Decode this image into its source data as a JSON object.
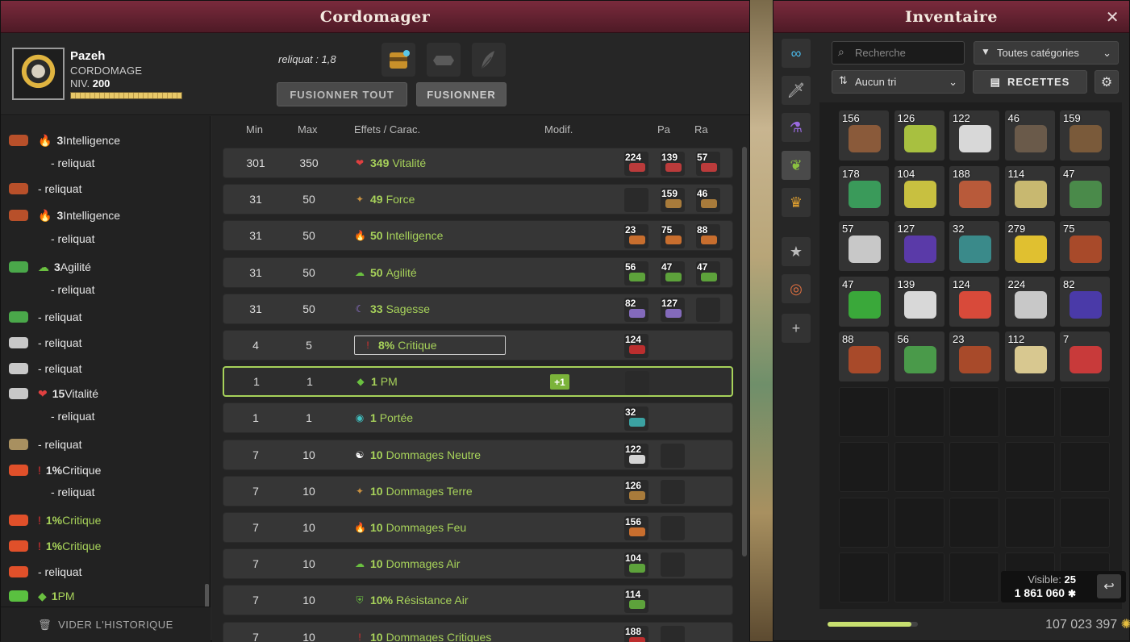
{
  "craft": {
    "title": "Cordomager",
    "player": {
      "name": "Pazeh",
      "job": "CORDOMAGE",
      "level_label": "NIV.",
      "level": "200"
    },
    "reliquat": "reliquat : 1,8",
    "buttons": {
      "fuse_all": "FUSIONNER TOUT",
      "fuse": "FUSIONNER"
    },
    "history_clear": "VIDER L'HISTORIQUE",
    "history": [
      {
        "icon": "rune-red",
        "bold": "3",
        "text": "Intelligence",
        "green": false,
        "stat": "fire"
      },
      {
        "icon": "",
        "bold": "",
        "text": "- reliquat",
        "green": false,
        "sub": true
      },
      {
        "icon": "rune-red",
        "bold": "",
        "text": "- reliquat",
        "green": false
      },
      {
        "icon": "rune-red",
        "bold": "3",
        "text": "Intelligence",
        "green": false,
        "stat": "fire"
      },
      {
        "icon": "",
        "bold": "",
        "text": "- reliquat",
        "green": false,
        "sub": true
      },
      {
        "icon": "rune-green",
        "bold": "3",
        "text": "Agilité",
        "green": false,
        "stat": "air"
      },
      {
        "icon": "",
        "bold": "",
        "text": "- reliquat",
        "green": false,
        "sub": true
      },
      {
        "icon": "rune-green",
        "bold": "",
        "text": "- reliquat",
        "green": false
      },
      {
        "icon": "rune-white",
        "bold": "",
        "text": "- reliquat",
        "green": false
      },
      {
        "icon": "rune-white",
        "bold": "",
        "text": "- reliquat",
        "green": false
      },
      {
        "icon": "rune-white",
        "bold": "15",
        "text": "Vitalité",
        "green": false,
        "stat": "heart"
      },
      {
        "icon": "",
        "bold": "",
        "text": "- reliquat",
        "green": false,
        "sub": true
      },
      {
        "icon": "rune-tan",
        "bold": "",
        "text": "- reliquat",
        "green": false
      },
      {
        "icon": "rune-crit",
        "bold": "1%",
        "text": "Critique",
        "green": false,
        "stat": "crit"
      },
      {
        "icon": "",
        "bold": "",
        "text": "- reliquat",
        "green": false,
        "sub": true
      },
      {
        "icon": "rune-crit",
        "bold": "1%",
        "text": "Critique",
        "green": true,
        "stat": "crit"
      },
      {
        "icon": "rune-crit",
        "bold": "1%",
        "text": "Critique",
        "green": true,
        "stat": "crit"
      },
      {
        "icon": "rune-crit",
        "bold": "",
        "text": "- reliquat",
        "green": false
      },
      {
        "icon": "rune-pm",
        "bold": "1",
        "text": "PM",
        "green": true,
        "stat": "pm"
      }
    ],
    "columns": {
      "min": "Min",
      "max": "Max",
      "effects": "Effets / Carac.",
      "modif": "Modif.",
      "pa": "Pa",
      "ra": "Ra"
    },
    "rows": [
      {
        "min": "301",
        "max": "350",
        "val": "349",
        "name": "Vitalité",
        "icon": "heart",
        "runes": [
          "224",
          "139",
          "57"
        ]
      },
      {
        "min": "31",
        "max": "50",
        "val": "49",
        "name": "Force",
        "icon": "earth",
        "runes": [
          "",
          "159",
          "46"
        ]
      },
      {
        "min": "31",
        "max": "50",
        "val": "50",
        "name": "Intelligence",
        "icon": "fire",
        "runes": [
          "23",
          "75",
          "88"
        ]
      },
      {
        "min": "31",
        "max": "50",
        "val": "50",
        "name": "Agilité",
        "icon": "air",
        "runes": [
          "56",
          "47",
          "47"
        ]
      },
      {
        "min": "31",
        "max": "50",
        "val": "33",
        "name": "Sagesse",
        "icon": "moon",
        "runes": [
          "82",
          "127",
          ""
        ]
      },
      {
        "min": "4",
        "max": "5",
        "val": "8%",
        "name": "Critique",
        "icon": "crit",
        "runes": [
          "124",
          null,
          null
        ],
        "boxed": true
      },
      {
        "min": "1",
        "max": "1",
        "val": "1",
        "name": "PM",
        "icon": "pm",
        "runes": [
          "",
          null,
          null
        ],
        "selected": true,
        "modif": "+1"
      },
      {
        "min": "1",
        "max": "1",
        "val": "1",
        "name": "Portée",
        "icon": "eye",
        "runes": [
          "32",
          null,
          null
        ]
      },
      {
        "min": "7",
        "max": "10",
        "val": "10",
        "name": "Dommages Neutre",
        "icon": "neutral",
        "runes": [
          "122",
          "",
          null
        ]
      },
      {
        "min": "7",
        "max": "10",
        "val": "10",
        "name": "Dommages Terre",
        "icon": "earth",
        "runes": [
          "126",
          "",
          null
        ]
      },
      {
        "min": "7",
        "max": "10",
        "val": "10",
        "name": "Dommages Feu",
        "icon": "fire",
        "runes": [
          "156",
          "",
          null
        ]
      },
      {
        "min": "7",
        "max": "10",
        "val": "10",
        "name": "Dommages Air",
        "icon": "air",
        "runes": [
          "104",
          "",
          null
        ]
      },
      {
        "min": "7",
        "max": "10",
        "val": "10%",
        "name": "Résistance Air",
        "icon": "shield",
        "runes": [
          "114",
          null,
          null
        ]
      },
      {
        "min": "7",
        "max": "10",
        "val": "10",
        "name": "Dommages Critiques",
        "icon": "crit",
        "runes": [
          "188",
          "",
          null
        ]
      }
    ]
  },
  "inventory": {
    "title": "Inventaire",
    "search_placeholder": "Recherche",
    "category": "Toutes catégories",
    "sort": "Aucun tri",
    "recipes": "RECETTES",
    "visible_label": "Visible:",
    "visible": "25",
    "pods": "1 861 060",
    "kamas": "107 023 397",
    "pods_fill_fraction": 0.93,
    "tabs": [
      "infinity-icon",
      "sword-icon",
      "potion-icon",
      "leaf-icon",
      "crown-icon",
      "star-icon",
      "target-icon",
      "plus-icon"
    ],
    "items": [
      {
        "q": "156",
        "c": "#8a5a3a"
      },
      {
        "q": "126",
        "c": "#a8c040"
      },
      {
        "q": "122",
        "c": "#d8d8d8"
      },
      {
        "q": "46",
        "c": "#6a5a4a"
      },
      {
        "q": "159",
        "c": "#7a5a3a"
      },
      {
        "q": "178",
        "c": "#3a9a5a"
      },
      {
        "q": "104",
        "c": "#c8c040"
      },
      {
        "q": "188",
        "c": "#b85a3a"
      },
      {
        "q": "114",
        "c": "#c8b870"
      },
      {
        "q": "47",
        "c": "#4a8a4a"
      },
      {
        "q": "57",
        "c": "#c8c8c8"
      },
      {
        "q": "127",
        "c": "#5a3aa8"
      },
      {
        "q": "32",
        "c": "#3a8a8a"
      },
      {
        "q": "279",
        "c": "#e0c030"
      },
      {
        "q": "75",
        "c": "#a84a2a"
      },
      {
        "q": "47",
        "c": "#3aa83a"
      },
      {
        "q": "139",
        "c": "#d8d8d8"
      },
      {
        "q": "124",
        "c": "#d84a3a"
      },
      {
        "q": "224",
        "c": "#c8c8c8"
      },
      {
        "q": "82",
        "c": "#4a3aa8"
      },
      {
        "q": "88",
        "c": "#a84a2a"
      },
      {
        "q": "56",
        "c": "#4a9a4a"
      },
      {
        "q": "23",
        "c": "#a84a2a"
      },
      {
        "q": "112",
        "c": "#d8c890"
      },
      {
        "q": "7",
        "c": "#c83a3a"
      }
    ]
  }
}
